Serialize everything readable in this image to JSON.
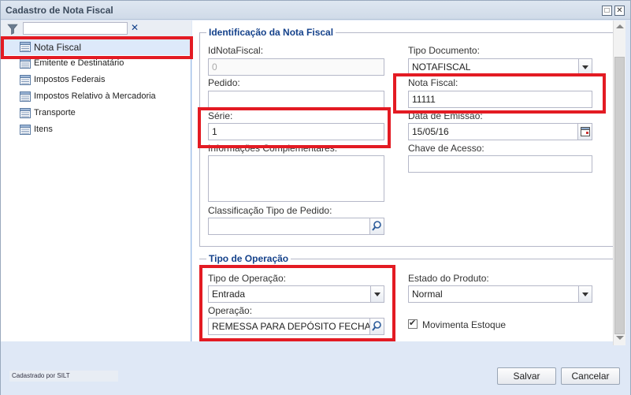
{
  "window": {
    "title": "Cadastro de Nota Fiscal",
    "maximize": "□",
    "close": "✕"
  },
  "filter": {
    "value": "",
    "clear": "✕"
  },
  "tree": [
    {
      "label": "Nota Fiscal",
      "selected": true
    },
    {
      "label": "Emitente e Destinatário"
    },
    {
      "label": "Impostos Federais"
    },
    {
      "label": "Impostos Relativo à Mercadoria"
    },
    {
      "label": "Transporte"
    },
    {
      "label": "Itens"
    }
  ],
  "identificacao": {
    "legend": "Identificação da Nota Fiscal",
    "id_label": "IdNotaFiscal:",
    "id_value": "0",
    "pedido_label": "Pedido:",
    "pedido_value": "",
    "serie_label": "Série:",
    "serie_value": "1",
    "info_label": "Informações Complementares:",
    "info_value": "",
    "classificacao_label": "Classificação Tipo de Pedido:",
    "classificacao_value": "",
    "tipo_doc_label": "Tipo Documento:",
    "tipo_doc_value": "NOTAFISCAL",
    "nota_label": "Nota Fiscal:",
    "nota_value": "11111",
    "data_label": "Data de Emissão:",
    "data_value": "15/05/16",
    "chave_label": "Chave de Acesso:",
    "chave_value": ""
  },
  "operacao": {
    "legend": "Tipo de Operação",
    "tipo_label": "Tipo de Operação:",
    "tipo_value": "Entrada",
    "op_label": "Operação:",
    "op_value": "REMESSA PARA DEPÓSITO FECHADO",
    "estado_label": "Estado do Produto:",
    "estado_value": "Normal",
    "movimenta_label": "Movimenta Estoque",
    "movimenta_checked": true
  },
  "footer": {
    "credit": "Cadastrado por SILT",
    "save": "Salvar",
    "cancel": "Cancelar"
  },
  "colors": {
    "highlight": "#e31b23",
    "legend": "#15428b"
  }
}
